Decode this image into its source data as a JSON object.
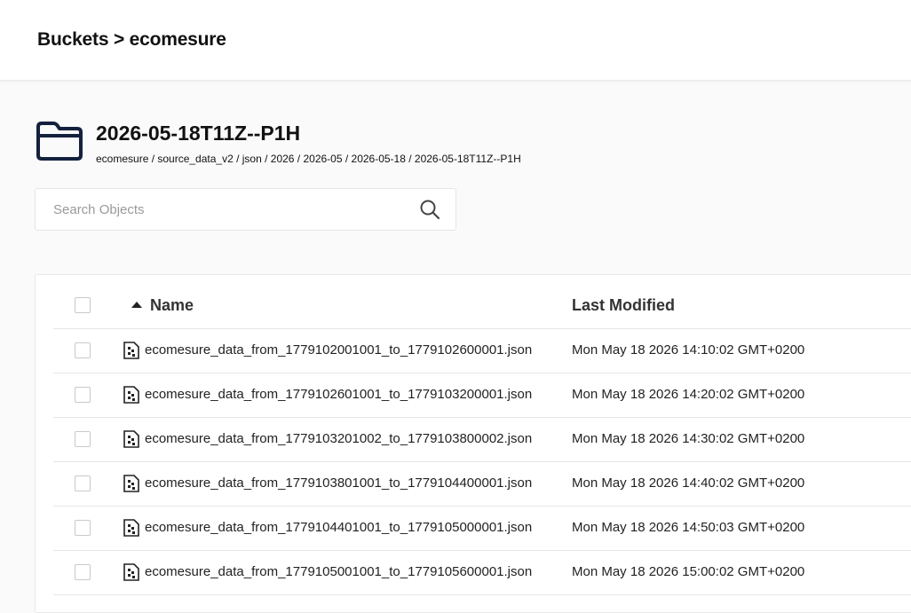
{
  "header": {
    "breadcrumb": "Buckets > ecomesure"
  },
  "folder": {
    "icon": "folder-icon",
    "name": "2026-05-18T11Z--P1H",
    "path": "ecomesure / source_data_v2 / json / 2026 / 2026-05 / 2026-05-18 / 2026-05-18T11Z--P1H"
  },
  "search": {
    "placeholder": "Search Objects",
    "value": "",
    "icon": "search-icon"
  },
  "table": {
    "columns": {
      "name": "Name",
      "last_modified": "Last Modified"
    },
    "sort": "name-ascending",
    "rows": [
      {
        "name": "ecomesure_data_from_1779102001001_to_1779102600001.json",
        "modified": "Mon May 18 2026 14:10:02 GMT+0200"
      },
      {
        "name": "ecomesure_data_from_1779102601001_to_1779103200001.json",
        "modified": "Mon May 18 2026 14:20:02 GMT+0200"
      },
      {
        "name": "ecomesure_data_from_1779103201002_to_1779103800002.json",
        "modified": "Mon May 18 2026 14:30:02 GMT+0200"
      },
      {
        "name": "ecomesure_data_from_1779103801001_to_1779104400001.json",
        "modified": "Mon May 18 2026 14:40:02 GMT+0200"
      },
      {
        "name": "ecomesure_data_from_1779104401001_to_1779105000001.json",
        "modified": "Mon May 18 2026 14:50:03 GMT+0200"
      },
      {
        "name": "ecomesure_data_from_1779105001001_to_1779105600001.json",
        "modified": "Mon May 18 2026 15:00:02 GMT+0200"
      }
    ]
  },
  "colors": {
    "folder_icon": "#14213d",
    "text": "#222222",
    "border": "#e6e6e6"
  }
}
